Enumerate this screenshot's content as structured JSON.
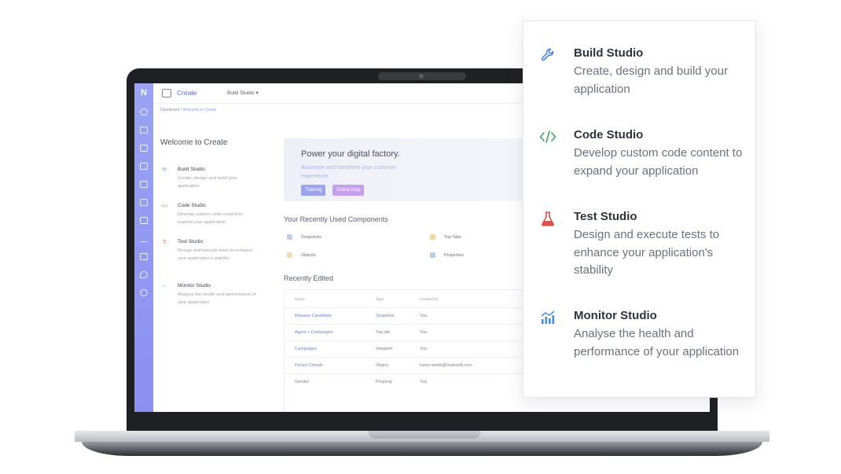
{
  "app": {
    "logo_letter": "N",
    "name": "Create",
    "studio_selector": "Build Studio ▾",
    "breadcrumb_home": "Dashboard",
    "breadcrumb_sep": "/",
    "breadcrumb_current": "Welcome to Create",
    "welcome_title": "Welcome to Create"
  },
  "rail_icons": [
    "home-icon",
    "database-icon",
    "branch-icon",
    "monitor-icon",
    "chat-icon",
    "image-icon",
    "book-icon",
    "swap-icon",
    "lock-icon",
    "location-icon",
    "settings-icon"
  ],
  "studios": [
    {
      "name": "Build Studio",
      "desc": "Create, design and build your application",
      "icon": "wrench-icon",
      "color": "#5b8def",
      "glyph": "🔧"
    },
    {
      "name": "Code Studio",
      "desc": "Develop custom code content to expand your application",
      "icon": "code-icon",
      "color": "#3aa35b",
      "glyph": "</>"
    },
    {
      "name": "Test Studio",
      "desc": "Design and execute tests to enhance your application's stability",
      "icon": "flask-icon",
      "color": "#e0534d",
      "glyph": "⚗"
    },
    {
      "name": "Monitor Studio",
      "desc": "Analyse the health and performance of your application",
      "icon": "chart-icon",
      "color": "#4a8fdf",
      "glyph": "📈"
    }
  ],
  "hero": {
    "title": "Power your digital factory.",
    "subtitle": "Automate and transform your customer experience.",
    "btn_training": "Training",
    "btn_help": "Online help"
  },
  "recent_components": {
    "title": "Your Recently Used Components",
    "items": [
      {
        "label": "Snapshots",
        "color": "#a7b0f0"
      },
      {
        "label": "Top Tabs",
        "color": "#f3c274"
      },
      {
        "label": "Objects",
        "color": "#f2cf7f"
      },
      {
        "label": "Properties",
        "color": "#8fb1e6"
      }
    ]
  },
  "recently_edited": {
    "title": "Recently Edited",
    "columns": [
      "Name",
      "Type",
      "Created by"
    ],
    "rows": [
      {
        "name": "Release Candidate",
        "type": "Snapshot",
        "by": "You",
        "link": true
      },
      {
        "name": "Agent > Campaigns",
        "type": "Top tab",
        "by": "You",
        "link": true
      },
      {
        "name": "Campaigns",
        "type": "Viewport",
        "by": "You",
        "link": true
      },
      {
        "name": "Person Details",
        "type": "Object",
        "by": "karen.webb@matssoft.com",
        "link": true
      },
      {
        "name": "Gender",
        "type": "Property",
        "by": "You",
        "link": false
      }
    ]
  },
  "colors": {
    "accent": "#5b6cd6",
    "rail": "#8b8ff0",
    "training_btn": "#9aa2f2",
    "help_btn": "#c59ef0"
  }
}
